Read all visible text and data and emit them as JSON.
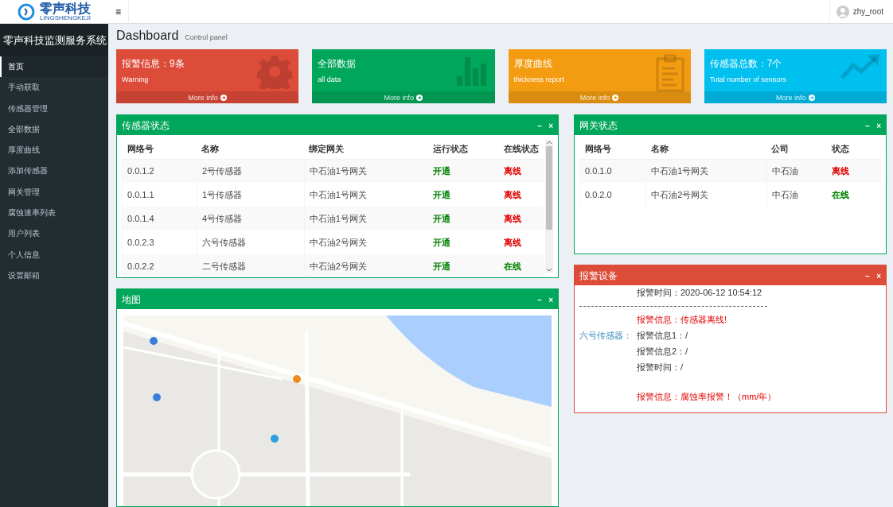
{
  "brand": {
    "name": "零声科技",
    "sub": "LINGSHENGKEJI"
  },
  "topbar": {
    "menu": "≡",
    "user": "zhy_root"
  },
  "sidebar": {
    "title": "零声科技监测服务系统",
    "items": [
      {
        "label": "首页",
        "selected": true
      },
      {
        "label": "手动获取",
        "selected": false
      },
      {
        "label": "传感器管理",
        "selected": false
      },
      {
        "label": "全部数据",
        "selected": false
      },
      {
        "label": "厚度曲线",
        "selected": false
      },
      {
        "label": "添加传感器",
        "selected": false
      },
      {
        "label": "网关管理",
        "selected": false
      },
      {
        "label": "腐蚀速率列表",
        "selected": false
      },
      {
        "label": "用户列表",
        "selected": false
      },
      {
        "label": "个人信息",
        "selected": false
      },
      {
        "label": "设置邮箱",
        "selected": false
      }
    ]
  },
  "header": {
    "title": "Dashboard",
    "subtitle": "Control panel"
  },
  "info_boxes": [
    {
      "title": "报警信息：9条",
      "subtitle": "Warning",
      "link": "More info",
      "color": "#dd4b39"
    },
    {
      "title": "全部数据",
      "subtitle": "all data",
      "link": "More info",
      "color": "#00a65a"
    },
    {
      "title": "厚度曲线",
      "subtitle": "thickness report",
      "link": "More info",
      "color": "#f39c12"
    },
    {
      "title": "传感器总数：7个",
      "subtitle": "Total number of sensors",
      "link": "More info",
      "color": "#00c0ef"
    }
  ],
  "sensor_panel": {
    "title": "传感器状态",
    "color": "#00a65a",
    "columns": [
      "网络号",
      "名称",
      "绑定网关",
      "运行状态",
      "在线状态"
    ],
    "rows": [
      {
        "cells": [
          "0.0.1.2",
          "2号传感器",
          "中石油1号网关"
        ],
        "run": {
          "text": "开通",
          "ok": true
        },
        "online": {
          "text": "离线",
          "ok": false
        }
      },
      {
        "cells": [
          "0.0.1.1",
          "1号传感器",
          "中石油1号网关"
        ],
        "run": {
          "text": "开通",
          "ok": true
        },
        "online": {
          "text": "离线",
          "ok": false
        }
      },
      {
        "cells": [
          "0.0.1.4",
          "4号传感器",
          "中石油1号网关"
        ],
        "run": {
          "text": "开通",
          "ok": true
        },
        "online": {
          "text": "离线",
          "ok": false
        }
      },
      {
        "cells": [
          "0.0.2.3",
          "六号传感器",
          "中石油2号网关"
        ],
        "run": {
          "text": "开通",
          "ok": true
        },
        "online": {
          "text": "离线",
          "ok": false
        }
      },
      {
        "cells": [
          "0.0.2.2",
          "二号传感器",
          "中石油2号网关"
        ],
        "run": {
          "text": "开通",
          "ok": true
        },
        "online": {
          "text": "在线",
          "ok": true
        }
      }
    ]
  },
  "gateway_panel": {
    "title": "网关状态",
    "color": "#00a65a",
    "columns": [
      "网络号",
      "名称",
      "公司",
      "状态"
    ],
    "rows": [
      {
        "cells": [
          "0.0.1.0",
          "中石油1号网关",
          "中石油"
        ],
        "status": {
          "text": "离线",
          "ok": false
        }
      },
      {
        "cells": [
          "0.0.2.0",
          "中石油2号网关",
          "中石油"
        ],
        "status": {
          "text": "在线",
          "ok": true
        }
      }
    ]
  },
  "map_panel": {
    "title": "地图",
    "color": "#00a65a",
    "kind": "picture"
  },
  "alarm_panel": {
    "title": "报警设备",
    "color": "#dd4b39",
    "lines": [
      {
        "kind": "plain",
        "text": "报警时间：2020-06-12 10:54:12"
      },
      {
        "kind": "rule"
      },
      {
        "kind": "alert",
        "text": "报警信息：传感器离线!"
      },
      {
        "kind": "plain",
        "label": "六号传感器：",
        "text": "报警信息1：/"
      },
      {
        "kind": "plain",
        "text": "报警信息2：/"
      },
      {
        "kind": "plain",
        "text": "报警时间：/"
      },
      {
        "kind": "gap"
      },
      {
        "kind": "alert",
        "text": "报警信息：腐蚀率报警！（mm/年）"
      }
    ]
  },
  "panel_tools": {
    "collapse": "−",
    "close": "×"
  }
}
